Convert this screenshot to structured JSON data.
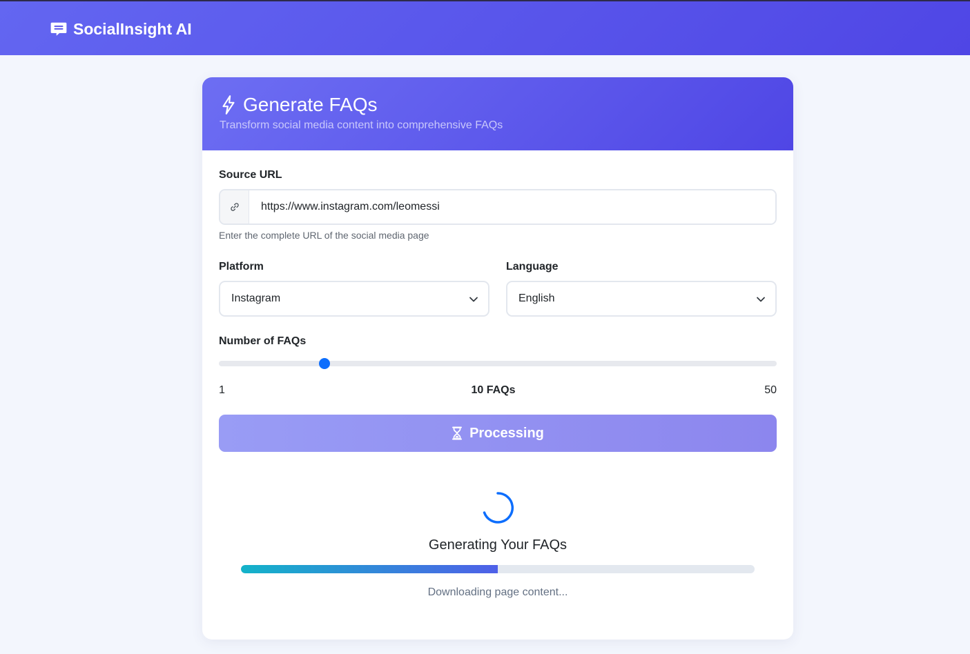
{
  "app": {
    "brand": "SocialInsight AI",
    "icon": "chat-message-icon"
  },
  "card": {
    "title": "Generate FAQs",
    "subtitle": "Transform social media content into comprehensive FAQs",
    "title_icon": "lightning-bolt-icon"
  },
  "form": {
    "source_url": {
      "label": "Source URL",
      "value": "https://www.instagram.com/leomessi",
      "help": "Enter the complete URL of the social media page",
      "icon": "link-icon"
    },
    "platform": {
      "label": "Platform",
      "selected": "Instagram"
    },
    "language": {
      "label": "Language",
      "selected": "English"
    },
    "faq_count": {
      "label": "Number of FAQs",
      "min": "1",
      "max": "50",
      "value": 10,
      "value_label": "10 FAQs"
    },
    "submit": {
      "label": "Processing",
      "icon": "hourglass-icon"
    }
  },
  "progress": {
    "title": "Generating Your FAQs",
    "status": "Downloading page content...",
    "percent": 50
  },
  "colors": {
    "primary": "#6366f1",
    "primary_dark": "#4f46e5",
    "slider_thumb": "#0d6efd",
    "progress_start": "#13b3c9",
    "progress_end": "#4f60e8"
  }
}
